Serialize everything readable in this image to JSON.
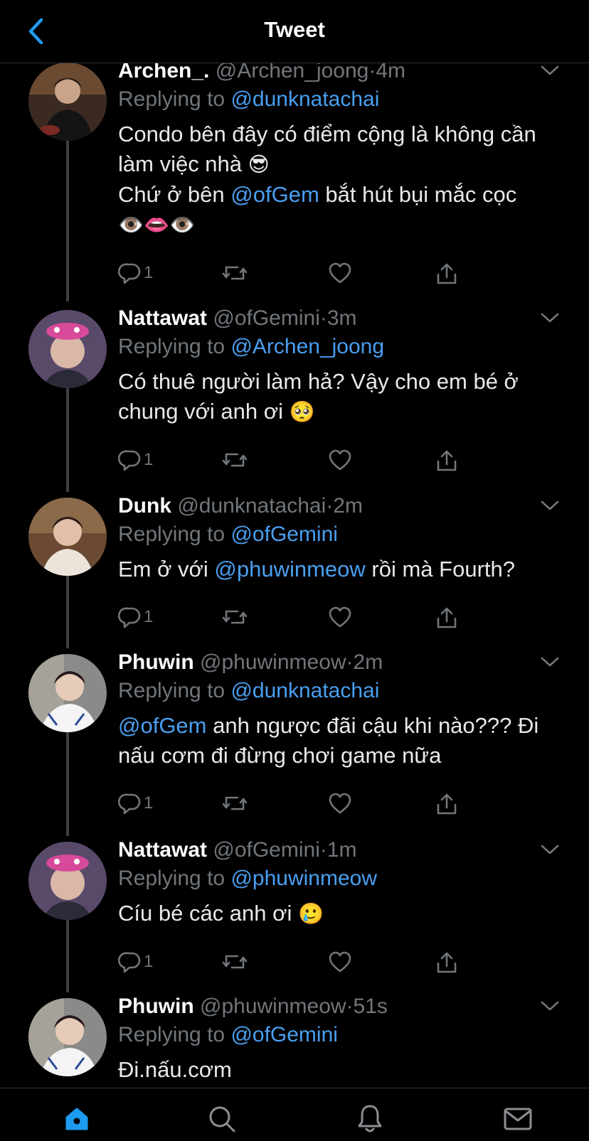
{
  "header": {
    "title": "Tweet"
  },
  "tweets": [
    {
      "name": "Archen_.",
      "handle": "@Archen_joong",
      "dot": "·",
      "time": "4m",
      "replying_prefix": "Replying to ",
      "replying_to": "@dunknatachai",
      "text_a": "Condo bên đây có điểm cộng là không cần làm việc nhà ",
      "emoji_a": "😎",
      "text_b": "Chứ ở bên ",
      "mention_b": "@ofGem",
      "text_c": " bắt hút bụi mắc cọc",
      "emoji_c": "👁️👄👁️",
      "reply_count": "1"
    },
    {
      "name": "Nattawat",
      "handle": "@ofGemini",
      "dot": "·",
      "time": "3m",
      "replying_prefix": "Replying to ",
      "replying_to": "@Archen_joong",
      "text_a": "Có thuê người làm hả? Vậy cho em bé ở chung với anh ơi ",
      "emoji_a": "🥺",
      "reply_count": "1"
    },
    {
      "name": "Dunk",
      "handle": "@dunknatachai",
      "dot": "·",
      "time": "2m",
      "replying_prefix": "Replying to ",
      "replying_to": "@ofGemini",
      "text_a": "Em ở với ",
      "mention_a": "@phuwinmeow",
      "text_b": " rồi mà Fourth?",
      "reply_count": "1"
    },
    {
      "name": "Phuwin",
      "handle": "@phuwinmeow",
      "dot": "·",
      "time": "2m",
      "replying_prefix": "Replying to ",
      "replying_to": "@dunknatachai",
      "mention_a": "@ofGem",
      "text_a": " anh ngược đãi cậu khi nào??? Đi nấu cơm đi đừng chơi game nữa",
      "reply_count": "1"
    },
    {
      "name": "Nattawat",
      "handle": "@ofGemini",
      "dot": "·",
      "time": "1m",
      "replying_prefix": "Replying to ",
      "replying_to": "@phuwinmeow",
      "text_a": "Cíu bé các anh ơi ",
      "emoji_a": "🥲",
      "reply_count": "1"
    },
    {
      "name": "Phuwin",
      "handle": "@phuwinmeow",
      "dot": "·",
      "time": "51s",
      "replying_prefix": "Replying to ",
      "replying_to": "@ofGemini",
      "text_a": "Đi.nấu.cơm"
    }
  ],
  "icons": {
    "back": "chevron-left-icon",
    "caret": "chevron-down-icon",
    "reply": "reply-icon",
    "retweet": "retweet-icon",
    "like": "heart-icon",
    "share": "share-icon",
    "home": "home-icon",
    "search": "search-icon",
    "notifications": "bell-icon",
    "messages": "mail-icon"
  },
  "colors": {
    "accent": "#1d9bf0",
    "mention": "#4a9ff0",
    "muted": "#71767b",
    "background": "#000000"
  }
}
